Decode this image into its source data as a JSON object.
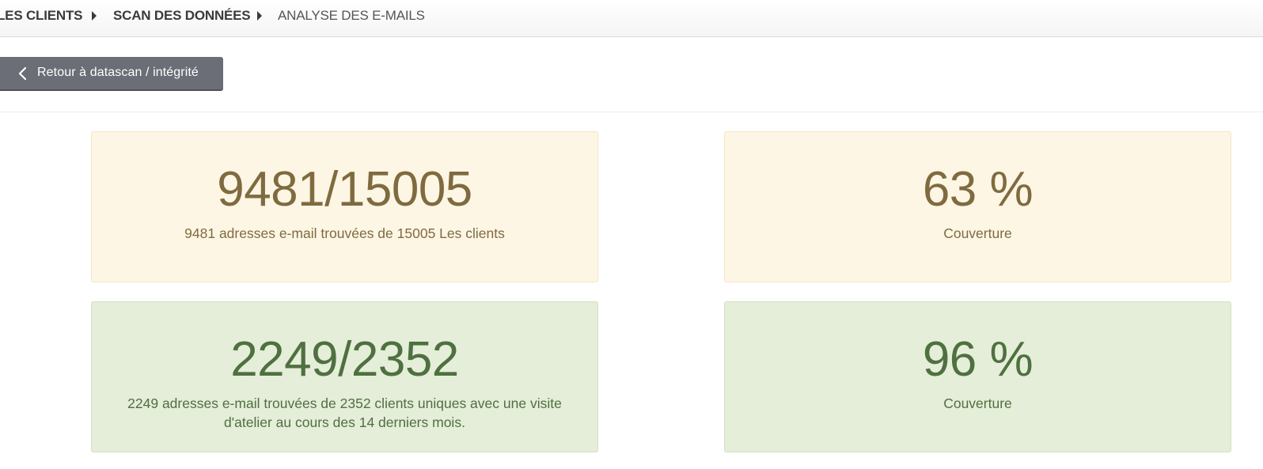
{
  "breadcrumb": {
    "items": [
      "LES CLIENTS",
      "SCAN DES DONNÉES",
      "ANALYSE DES E-MAILS"
    ]
  },
  "back_button": {
    "label": "Retour à datascan / intégrité",
    "icon": "chevron-left-icon"
  },
  "stats": [
    {
      "value": "9481/15005",
      "description": "9481 adresses e-mail trouvées de 15005 Les clients",
      "status": "warning"
    },
    {
      "value": "63 %",
      "description": "Couverture",
      "status": "warning"
    },
    {
      "value": "2249/2352",
      "description": "2249 adresses e-mail trouvées de 2352 clients uniques avec une visite d'atelier au cours des 14 derniers mois.",
      "status": "success"
    },
    {
      "value": "96 %",
      "description": "Couverture",
      "status": "success"
    }
  ],
  "colors": {
    "warning_bg": "#fdf6e5",
    "warning_text": "#7f6b3f",
    "success_bg": "#e5eed9",
    "success_text": "#4f7040",
    "button_bg": "#6b6e77"
  }
}
